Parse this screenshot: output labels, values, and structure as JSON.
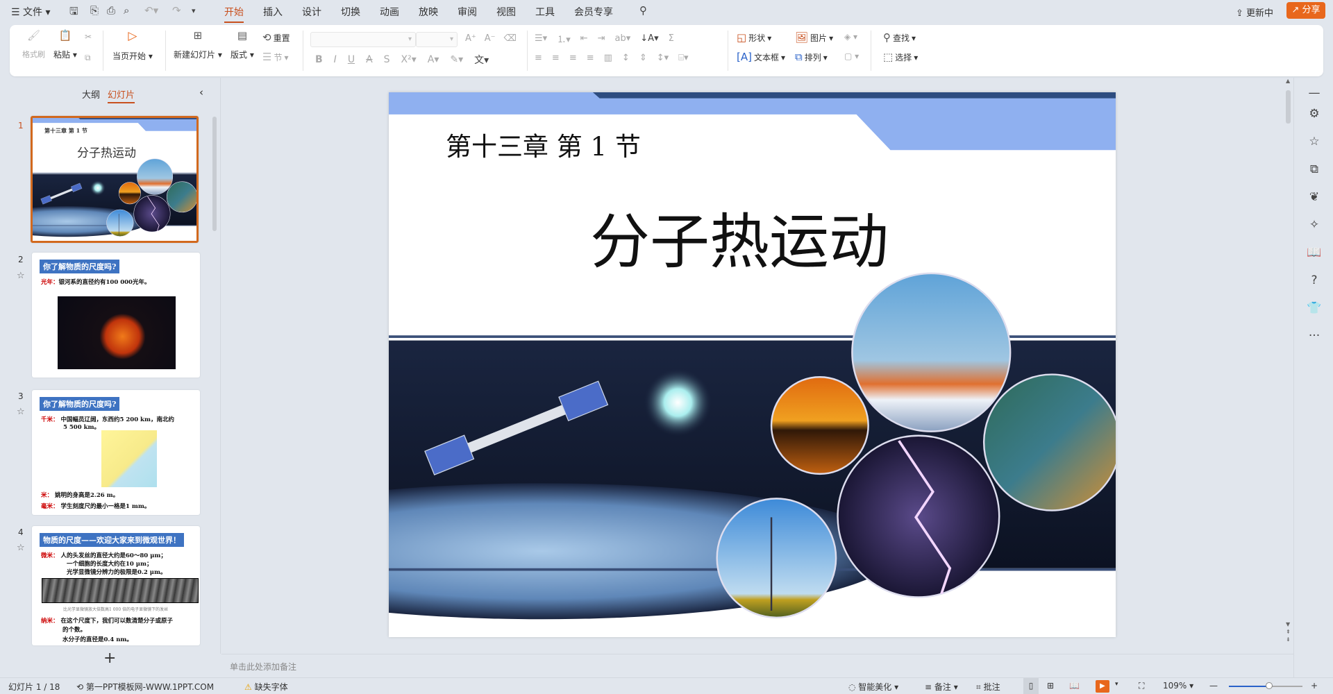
{
  "menu": {
    "file": "文件",
    "tabs": [
      "开始",
      "插入",
      "设计",
      "切换",
      "动画",
      "放映",
      "审阅",
      "视图",
      "工具",
      "会员专享"
    ],
    "active_tab": "开始",
    "update": "更新中",
    "share": "分享"
  },
  "ribbon": {
    "format_painter": "格式刷",
    "paste": "粘贴",
    "play_from_current": "当页开始",
    "new_slide": "新建幻灯片",
    "layout": "版式",
    "reset": "重置",
    "section": "节",
    "shape": "形状",
    "picture": "图片",
    "textbox": "文本框",
    "arrange": "排列",
    "find": "查找",
    "select": "选择"
  },
  "panel": {
    "tab_outline": "大纲",
    "tab_slides": "幻灯片",
    "add_slide": "+"
  },
  "thumbnails": [
    {
      "num": "1",
      "chapter": "第十三章  第 1 节",
      "title": "分子热运动"
    },
    {
      "num": "2",
      "heading": "你了解物质的尺度吗?",
      "lines": [
        {
          "label": "光年：",
          "text": "银河系的直径约有100 000光年。"
        }
      ]
    },
    {
      "num": "3",
      "heading": "你了解物质的尺度吗?",
      "lines": [
        {
          "label": "千米：",
          "text": "中国幅员辽阔，东西约5 200 km，南北约"
        },
        {
          "label": "",
          "text": "5 500 km。"
        },
        {
          "label": "米：",
          "text": "姚明的身高是2.26 m。"
        },
        {
          "label": "毫米：",
          "text": "学生刻度尺的最小一格是1 mm。"
        }
      ]
    },
    {
      "num": "4",
      "heading": "物质的尺度——欢迎大家来到微观世界！",
      "lines": [
        {
          "label": "微米：",
          "text": "人的头发丝的直径大约是60～80 μm；"
        },
        {
          "label": "",
          "text": "一个细胞的长度大约在10 μm；"
        },
        {
          "label": "",
          "text": "光学显微镜分辨力的极限是0.2 μm。"
        },
        {
          "label": "",
          "text": "比光学显微镜放大倍数高1 000 倍的电子显微镜下的发丝"
        },
        {
          "label": "纳米：",
          "text": "在这个尺度下，我们可以数清楚分子或原子"
        },
        {
          "label": "",
          "text": "的个数。"
        },
        {
          "label": "",
          "text": "水分子的直径是0.4 nm。"
        }
      ]
    }
  ],
  "slide": {
    "chapter": "第十三章  第 1 节",
    "title": "分子热运动"
  },
  "notes_placeholder": "单击此处添加备注",
  "status": {
    "slide_counter": "幻灯片 1 / 18",
    "template": "第一PPT模板网-WWW.1PPT.COM",
    "missing_font": "缺失字体",
    "beautify": "智能美化",
    "notes": "备注",
    "comments": "批注",
    "zoom": "109%",
    "zoom_fraction": 0.55
  },
  "colors": {
    "accent": "#c8501e",
    "share": "#e8671c",
    "slide_band": "#8fb0f0",
    "heading_blue": "#3e73c2"
  }
}
